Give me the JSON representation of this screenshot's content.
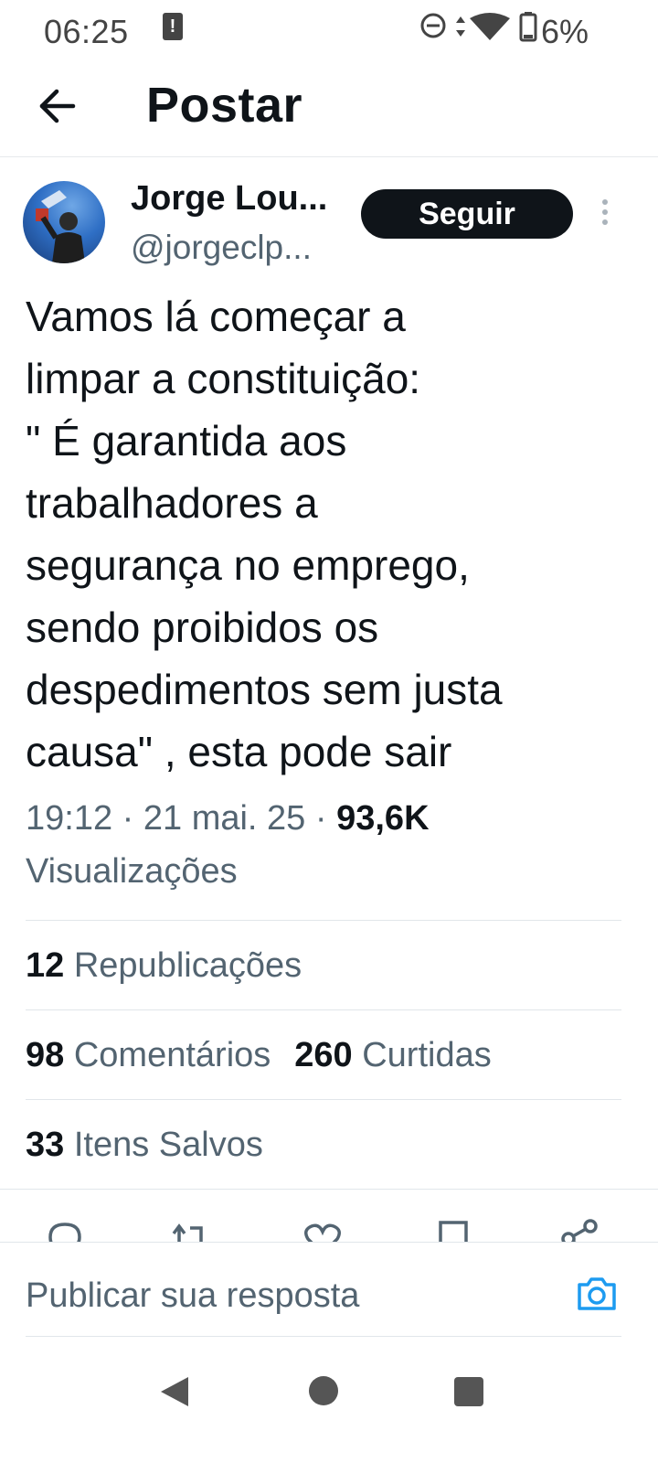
{
  "status_bar": {
    "time": "06:25",
    "alert_glyph": "!",
    "battery_percent": "6%",
    "icons": [
      "dnd-icon",
      "data-arrows-icon",
      "wifi-icon",
      "battery-icon"
    ]
  },
  "header": {
    "title": "Postar",
    "back_icon": "arrow-left-icon"
  },
  "author": {
    "name": "Jorge Lou...",
    "handle": "@jorgeclp...",
    "follow_label": "Seguir",
    "more_icon": "more-vertical-icon"
  },
  "tweet": {
    "text": "Vamos lá começar a\nlimpar a constituição:\n\"  É garantida aos\ntrabalhadores a\nsegurança no emprego,\nsendo proibidos os\ndespedimentos sem justa\ncausa\" , esta pode sair"
  },
  "meta": {
    "time": "19:12",
    "separator": "·",
    "date": "21 mai. 25",
    "views_count": "93,6K",
    "views_label": "Visualizações"
  },
  "stats": {
    "reposts_count": "12",
    "reposts_label": "Republicações",
    "comments_count": "98",
    "comments_label": "Comentários",
    "likes_count": "260",
    "likes_label": "Curtidas",
    "saves_count": "33",
    "saves_label": "Itens Salvos"
  },
  "actions": [
    "reply-icon",
    "repost-icon",
    "like-icon",
    "bookmark-icon",
    "share-icon"
  ],
  "reply": {
    "placeholder": "Publicar sua resposta",
    "camera_icon": "camera-icon"
  },
  "colors": {
    "text_primary": "#0f1419",
    "text_secondary": "#536471",
    "divider": "#e1e6ea",
    "accent": "#1d9bf0",
    "button_dark": "#0f1419"
  }
}
